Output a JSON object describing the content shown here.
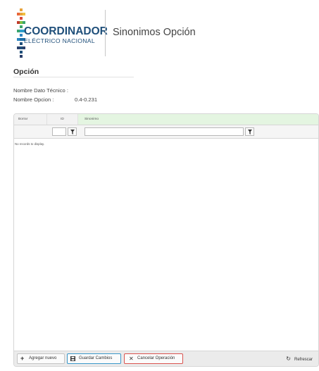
{
  "header": {
    "logo_text_primary": "COORDINADOR",
    "logo_text_secondary": "ELÉCTRICO NACIONAL",
    "page_title": "Sinonimos Opción"
  },
  "section": {
    "title": "Opción",
    "fields": [
      {
        "label": "Nombre Dato Técnico :",
        "value": ""
      },
      {
        "label": "Nombre Opcion :",
        "value": "0.4-0.231"
      }
    ]
  },
  "grid": {
    "columns": [
      "Borrar",
      "ID",
      "Sinonimo"
    ],
    "filters": {
      "id_value": "",
      "sinonimo_value": ""
    },
    "empty_message": "No records to display.",
    "rows": []
  },
  "footer": {
    "add_label": "Agregar nuevo",
    "save_label": "Guardar Cambios",
    "cancel_label": "Cancelar Operación",
    "refresh_label": "Refrescar"
  },
  "colors": {
    "sinonimo_header_bg": "#e4f5e1",
    "save_border": "#3a97c9",
    "cancel_border": "#d9534f",
    "logo_blue": "#1f4f7a"
  },
  "icons": {
    "filter": "filter-icon",
    "add": "plus-icon",
    "save": "floppy-disk-icon",
    "cancel": "close-icon",
    "refresh": "refresh-icon"
  }
}
